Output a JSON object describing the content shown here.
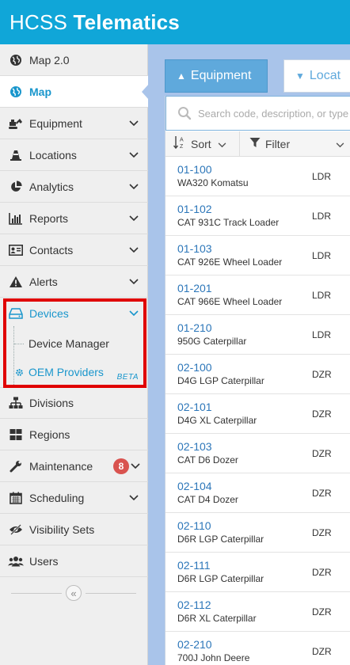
{
  "app": {
    "title_light": "HCSS",
    "title_bold": "Telematics"
  },
  "sidebar": {
    "items": [
      {
        "label": "Map 2.0",
        "icon": "globe-icon"
      },
      {
        "label": "Map",
        "icon": "globe-icon",
        "active": true
      },
      {
        "label": "Equipment",
        "icon": "excavator-icon"
      },
      {
        "label": "Locations",
        "icon": "traffic-cone-icon"
      },
      {
        "label": "Analytics",
        "icon": "pie-chart-icon"
      },
      {
        "label": "Reports",
        "icon": "bar-chart-icon"
      },
      {
        "label": "Contacts",
        "icon": "contact-card-icon"
      },
      {
        "label": "Alerts",
        "icon": "warning-icon"
      },
      {
        "label": "Devices",
        "icon": "hard-drive-icon",
        "expanded": true
      },
      {
        "label": "Divisions",
        "icon": "sitemap-icon"
      },
      {
        "label": "Regions",
        "icon": "grid-icon"
      },
      {
        "label": "Maintenance",
        "icon": "wrench-icon",
        "badge": "8"
      },
      {
        "label": "Scheduling",
        "icon": "calendar-icon"
      },
      {
        "label": "Visibility Sets",
        "icon": "eye-slash-icon"
      },
      {
        "label": "Users",
        "icon": "users-icon"
      }
    ],
    "devices_sub": {
      "device_manager": "Device Manager",
      "oem_providers": "OEM Providers",
      "beta": "BETA"
    },
    "collapse_glyph": "«"
  },
  "tabs": {
    "equipment": "Equipment",
    "locations": "Locat"
  },
  "search": {
    "placeholder": "Search code, description, or type..."
  },
  "toolbar": {
    "sort": "Sort",
    "filter": "Filter"
  },
  "equipment_rows": [
    {
      "code": "01-100",
      "desc": "WA320 Komatsu",
      "type": "LDR"
    },
    {
      "code": "01-102",
      "desc": "CAT 931C Track Loader",
      "type": "LDR"
    },
    {
      "code": "01-103",
      "desc": "CAT 926E Wheel Loader",
      "type": "LDR"
    },
    {
      "code": "01-201",
      "desc": "CAT 966E Wheel Loader",
      "type": "LDR"
    },
    {
      "code": "01-210",
      "desc": "950G Caterpillar",
      "type": "LDR"
    },
    {
      "code": "02-100",
      "desc": "D4G LGP Caterpillar",
      "type": "DZR"
    },
    {
      "code": "02-101",
      "desc": "D4G XL Caterpillar",
      "type": "DZR"
    },
    {
      "code": "02-103",
      "desc": "CAT D6 Dozer",
      "type": "DZR"
    },
    {
      "code": "02-104",
      "desc": "CAT D4 Dozer",
      "type": "DZR"
    },
    {
      "code": "02-110",
      "desc": "D6R LGP Caterpillar",
      "type": "DZR"
    },
    {
      "code": "02-111",
      "desc": "D6R LGP Caterpillar",
      "type": "DZR"
    },
    {
      "code": "02-112",
      "desc": "D6R XL Caterpillar",
      "type": "DZR"
    },
    {
      "code": "02-210",
      "desc": "700J John Deere",
      "type": "DZR"
    }
  ],
  "colors": {
    "header": "#10a6d8",
    "accent": "#1996cc",
    "highlight": "#e00000",
    "badge": "#d9534f"
  }
}
